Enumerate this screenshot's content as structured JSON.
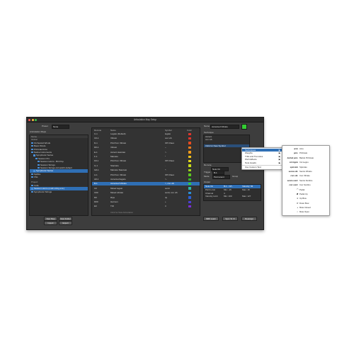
{
  "window": {
    "title": "Articulation Map Setup",
    "traffic_lights": [
      "#fc5b57",
      "#fdbc40",
      "#34c84a"
    ]
  },
  "top": {
    "preset_label": "Preset",
    "preset_value": "None",
    "name_label": "Name",
    "name_value": "Accented Vibrato",
    "color_swatch": "#33cc33"
  },
  "left": {
    "map_header": "Articulation Maps",
    "name_col": "Name",
    "global_header": "Global",
    "global_items": [
      "Orchestral Winds",
      "Basic Winds",
      "Pizzicato/Arco",
      "Native Instruments",
      "Symphonic Series",
      "Session Pro",
      "Session Horns - Brit Pop",
      "Session Strings",
      "Session Strings old switch default"
    ],
    "selected_item": "Symphonic Series",
    "more_items": [
      "Spitfire",
      "VSL"
    ],
    "project_header": "Project",
    "project_items": [
      "Cello",
      "Session Horns (multi string exs.)",
      "Symphonic Strings"
    ],
    "buttons": {
      "new_map": "New Map",
      "new_folder": "New Folder",
      "import": "Import",
      "export": "Export"
    }
  },
  "table": {
    "headers": {
      "remote": "Remote",
      "name": "Name",
      "symbol": "Symbol",
      "color": "Color"
    },
    "rows": [
      {
        "remote": "C-1",
        "name": "Legato (Default)",
        "symbol": "legato",
        "color": "#e0352b"
      },
      {
        "remote": "C#-1",
        "name": "Vibrato",
        "symbol": "con vib",
        "color": "#e0352b"
      },
      {
        "remote": "D-1",
        "name": "Pizz/Con Vibrato",
        "symbol": "Off Chaos",
        "color": "#e94a1f"
      },
      {
        "remote": "D#-1",
        "name": "Vibrato",
        "symbol": "~",
        "color": "#f07a1a"
      },
      {
        "remote": "E-1",
        "name": "Accent staccato",
        "symbol": ">.",
        "color": "#f09a1a"
      },
      {
        "remote": "F-1",
        "name": "Marcato",
        "symbol": "^",
        "color": "#f2c21a"
      },
      {
        "remote": "F#-1",
        "name": "Pizz/Con Vibrato",
        "symbol": "Off Chaos",
        "color": "#e8d81a"
      },
      {
        "remote": "G-1",
        "name": "Staccato",
        "symbol": ".",
        "color": "#c9dc1a"
      },
      {
        "remote": "G#-1",
        "name": "Marcato Staccato",
        "symbol": "^.",
        "color": "#9fd21a"
      },
      {
        "remote": "A-1",
        "name": "Pizz/Con Vibrato",
        "symbol": "Off Chaos",
        "color": "#5cc61f"
      },
      {
        "remote": "A#-1",
        "name": "Accented legato",
        "symbol": ">-",
        "color": "#33b82a"
      },
      {
        "remote": "B-1",
        "name": "Accented Vibrato",
        "symbol": ">, con vib",
        "color": "#33cc33"
      },
      {
        "remote": "C0",
        "name": "Muted legato",
        "symbol": "sordi",
        "color": "#2fb8a8"
      },
      {
        "remote": "C#0",
        "name": "Muted vibrato",
        "symbol": "sordi, con vib",
        "color": "#2a8fd6"
      },
      {
        "remote": "D0",
        "name": "Rips",
        "symbol": "rip",
        "color": "#2a5fd6"
      },
      {
        "remote": "D#0",
        "name": "Harmon",
        "symbol": "+",
        "color": "#4a3fd6"
      },
      {
        "remote": "E0",
        "name": "Trill",
        "symbol": "tr",
        "color": "#7a2fd6"
      }
    ],
    "add_row": "Click for New Articulation",
    "selected_row": 11
  },
  "right": {
    "techniques_header": "Technique",
    "techniques_items": [
      "Accent",
      "con vib"
    ],
    "click_new": "Click for New Symbol",
    "remote_label": "Remote",
    "remote_value": "B-1",
    "mode_label": "Mode",
    "mode_value": "Permanent",
    "group_label": "Group",
    "trigger_label": "Trigger",
    "mode_detail": "Note On",
    "output_header": "Output",
    "output_rows": [
      {
        "a": "Note On",
        "b": "B-1 - C# - ",
        "c": "Velocity: 84"
      },
      {
        "a": "Pitch Limit",
        "b": "Min: -15",
        "c": "Max: 15"
      },
      {
        "a": "Channel",
        "b": "4",
        "c": ""
      },
      {
        "a": "Velocity Limit",
        "b": "Min: 100",
        "c": "Max: 127"
      }
    ],
    "buttons": {
      "mixer_learn": "MIDI Learn",
      "sync": "Sync To VI",
      "reassign": "Reassign"
    }
  },
  "context_menu": {
    "items": [
      {
        "label": "Techniques",
        "arrow": "▶"
      },
      {
        "label": "Weights",
        "arrow": "▶"
      },
      {
        "label": "Trills and Tremolos",
        "arrow": "▶"
      },
      {
        "label": "Pitch Effects",
        "arrow": "▶"
      },
      {
        "label": "Note Heads",
        "arrow": "▶"
      },
      {
        "label": "Use Custom Text",
        "arrow": ""
      }
    ],
    "highlighted": 0
  },
  "submenu": {
    "items": [
      {
        "symbol": "arco",
        "name": "Arco"
      },
      {
        "symbol": "pizz.",
        "name": "Pizzicato"
      },
      {
        "symbol": "bartok pizz.",
        "name": "Bartok Pizzicato"
      },
      {
        "symbol": "col legno",
        "name": "Col Legno"
      },
      {
        "symbol": "spiccato",
        "name": "Spiccato"
      },
      {
        "symbol": "senza vib.",
        "name": "Senza Vibrato"
      },
      {
        "symbol": "con vib.",
        "name": "Con Vibrato"
      },
      {
        "symbol": "senza sord.",
        "name": "Senza Sordino"
      },
      {
        "symbol": "con sord.",
        "name": "Con Sordino"
      },
      {
        "symbol": "⌒",
        "name": "Pedal"
      },
      {
        "symbol": "✱",
        "name": "Pedal Up"
      },
      {
        "symbol": "∨",
        "name": "Up Bow"
      },
      {
        "symbol": "⊓",
        "name": "Down Bow"
      },
      {
        "symbol": "+",
        "name": "Mute Closed"
      },
      {
        "symbol": "○",
        "name": "Mute Open"
      }
    ]
  }
}
